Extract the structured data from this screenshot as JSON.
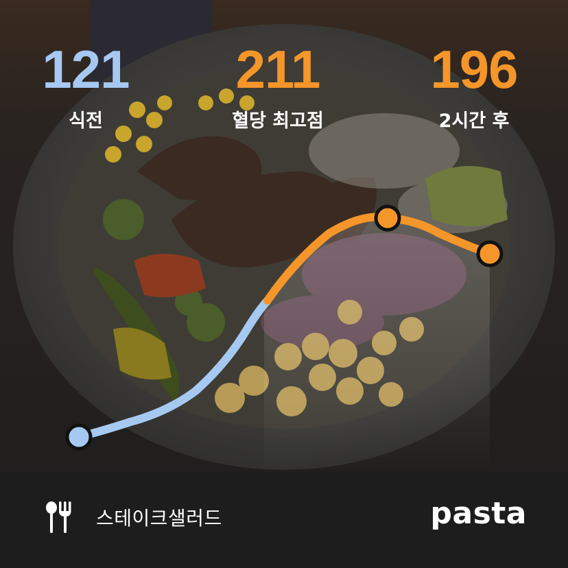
{
  "stats": {
    "before": {
      "value": "121",
      "label": "식전",
      "color": "#A6C9F2"
    },
    "peak": {
      "value": "211",
      "label": "혈당 최고점",
      "color": "#F5962A"
    },
    "after": {
      "value": "196",
      "label": "2시간 후",
      "color": "#F5962A"
    }
  },
  "colors": {
    "normal_range": "#A6C9F2",
    "high_range": "#F5962A"
  },
  "meal": {
    "icon": "fork-knife-icon",
    "name": "스테이크샐러드"
  },
  "brand": {
    "logo_text": "pasta"
  }
}
